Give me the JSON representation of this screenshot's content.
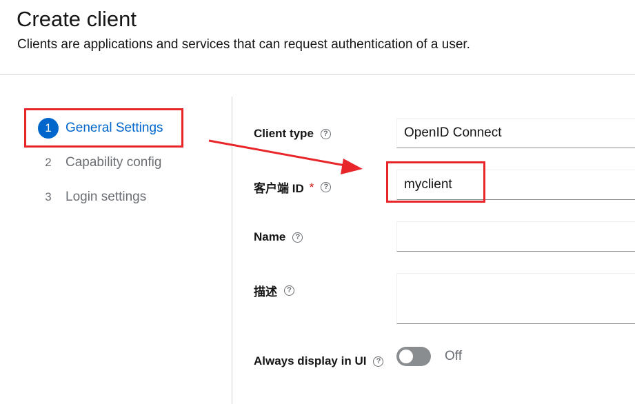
{
  "header": {
    "title": "Create client",
    "subtitle": "Clients are applications and services that can request authentication of a user."
  },
  "wizard": {
    "steps": [
      {
        "number": "1",
        "label": "General Settings",
        "current": true
      },
      {
        "number": "2",
        "label": "Capability config",
        "current": false
      },
      {
        "number": "3",
        "label": "Login settings",
        "current": false
      }
    ]
  },
  "form": {
    "client_type": {
      "label": "Client type",
      "value": "OpenID Connect"
    },
    "client_id": {
      "label": "客户端 ID",
      "required_marker": "*",
      "value": "myclient"
    },
    "name": {
      "label": "Name",
      "value": ""
    },
    "description": {
      "label": "描述",
      "value": ""
    },
    "always_display": {
      "label": "Always display in UI",
      "state_text": "Off",
      "on": false
    }
  },
  "icons": {
    "help": "help-circle-icon",
    "annotation_arrow": "red-arrow-annotation"
  },
  "colors": {
    "accent": "#0066cc",
    "annotation": "#e8262a",
    "required": "#c9190b"
  }
}
